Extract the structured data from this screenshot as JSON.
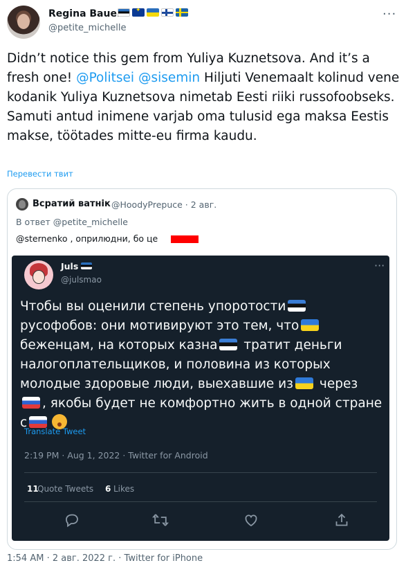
{
  "author": {
    "name": "Regina Bauer",
    "handle": "@petite_michelle",
    "flags": [
      "flag-estonia",
      "flag-eu",
      "flag-ukraine",
      "flag-finland",
      "flag-sweden"
    ]
  },
  "tweet": {
    "intro": "Didn’t notice this gem from Yuliya Kuznetsova. And it’s a fresh one! ",
    "mention1": "@Politsei",
    "mention2": "@sisemin",
    "body": " Hiljuti Venemaalt kolinud vene kodanik Yuliya Kuznetsova nimetab Eesti riiki russofoobseks. Samuti antud inimene varjab oma tulusid ega maksa Eestis makse, töötades mitte-eu firma kaudu.",
    "translate_label": "Перевести твит"
  },
  "quote": {
    "name": "Всратий ватнік",
    "handle_date": "@HoodyPrepuce · 2 авг.",
    "reply_to": "В ответ @petite_michelle",
    "body": "@sternenko , оприлюдни, бо це",
    "redaction_color": "#ff0000"
  },
  "embedded": {
    "name": "Juls",
    "handle": "@julsmao",
    "text": {
      "p1": "Чтобы вы оценили степень упоротости",
      "p2": "русофобов: они мотивируют это тем, что",
      "p3": "беженцам, на которых казна",
      "p4": "тратит деньги налогоплательщиков, и половина из которых молодые здоровые люди, выехавшие из",
      "p5": "через",
      "p6": ", якобы будет не комфортно жить в одной стране с"
    },
    "translate_label": "Translate Tweet",
    "timestamp": "2:19 PM · Aug 1, 2022 · Twitter for Android",
    "quote_tweets_count": "11",
    "quote_tweets_label": "Quote Tweets",
    "likes_count": "6",
    "likes_label": "Likes",
    "colors": {
      "background": "#15202b",
      "link": "#1d9bf0"
    }
  },
  "footer": {
    "timestamp": "1:54 AM · 2 авг. 2022 г. · Twitter for iPhone"
  },
  "colors": {
    "link": "#1d9bf0",
    "secondary_text": "#536471"
  }
}
